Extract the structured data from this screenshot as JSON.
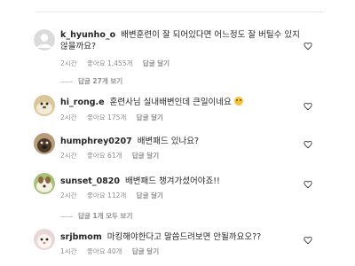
{
  "comments": [
    {
      "username": "k_hyunho_o",
      "text": "배변훈련이 잘 되어있다면 어느정도 잘 버틸수 있지 않을까요?",
      "time": "2시간",
      "likes": "좋아요 1,455개",
      "reply": "답글 달기",
      "view_replies": "답글 27개 보기"
    },
    {
      "username": "hi_rong.e",
      "text": "훈련사님 실내배변인데 큰일이네요",
      "emoji": "sad-face",
      "time": "2시간",
      "likes": "좋아요 175개",
      "reply": "답글 달기"
    },
    {
      "username": "humphrey0207",
      "text": "배변패드 있나요?",
      "time": "2시간",
      "likes": "좋아요 61개",
      "reply": "답글 달기"
    },
    {
      "username": "sunset_0820",
      "text": "배변패드 챙겨가셨어야죠!!",
      "time": "2시간",
      "likes": "좋아요 112개",
      "reply": "답글 달기",
      "view_replies": "답글 1개 모두 보기"
    },
    {
      "username": "srjbmom",
      "text": "마킹해야한다고 말씀드려보면 안될까요오??",
      "time": "1시간",
      "likes": "좋아요 40개",
      "reply": "답글 달기"
    }
  ],
  "colors": {
    "text": "#262626",
    "meta": "#8e8e8e",
    "divider": "#c7c7c7"
  },
  "icons": {
    "like": "heart-outline-icon",
    "avatar": "avatar-photo"
  }
}
